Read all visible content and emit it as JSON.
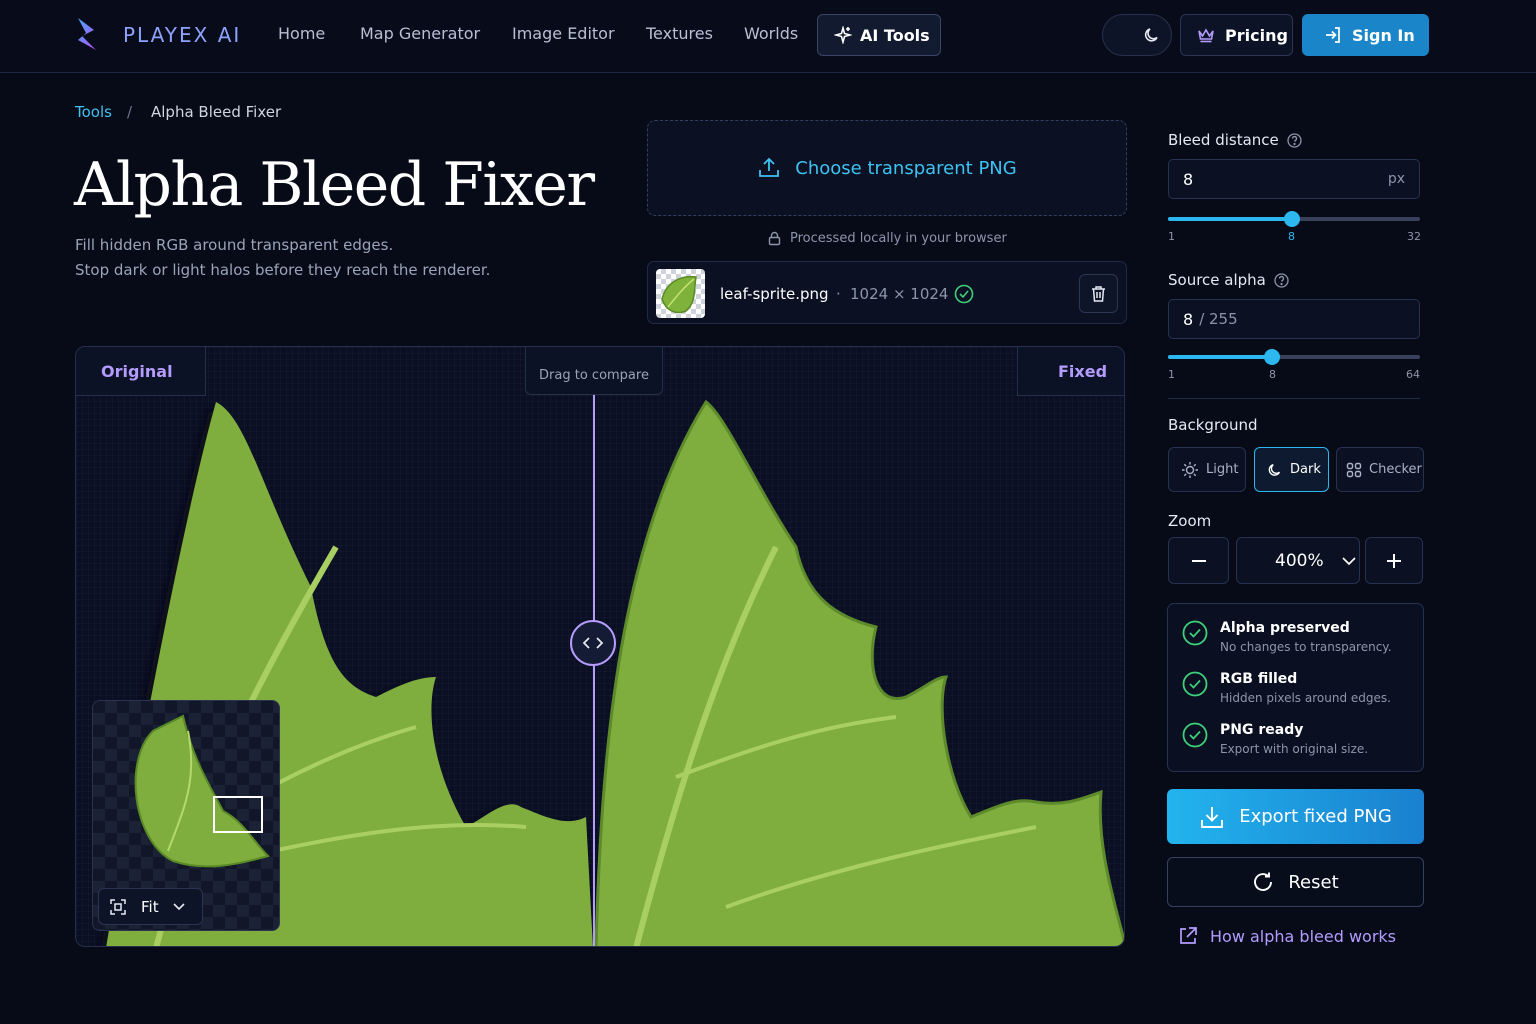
{
  "nav": {
    "brand": "PLAYEX AI",
    "links": [
      "Home",
      "Map Generator",
      "Image Editor",
      "Textures",
      "Worlds"
    ],
    "ai_tools": "AI Tools",
    "pricing": "Pricing",
    "sign_in": "Sign In"
  },
  "breadcrumb": {
    "root": "Tools",
    "sep": "/",
    "current": "Alpha Bleed Fixer"
  },
  "page": {
    "title": "Alpha Bleed Fixer",
    "subtitle_1": "Fill hidden RGB around transparent edges.",
    "subtitle_2": "Stop dark or light halos before they reach the renderer."
  },
  "upload": {
    "label": "Choose transparent PNG",
    "note": "Processed locally in your browser"
  },
  "file": {
    "name": "leaf-sprite.png",
    "dot": "·",
    "dims": "1024 × 1024"
  },
  "viewer": {
    "original": "Original",
    "fixed": "Fixed",
    "drag": "Drag to compare",
    "fit": "Fit",
    "split": 0.493
  },
  "settings": {
    "bleed_label": "Bleed distance",
    "bleed_value": "8",
    "bleed_unit": "px",
    "bleed_min": "1",
    "bleed_cur": "8",
    "bleed_max": "32",
    "alpha_label": "Source alpha",
    "alpha_value": "8",
    "alpha_denom": "/ 255",
    "alpha_min": "1",
    "alpha_cur": "8",
    "alpha_max": "64",
    "bg_label": "Background",
    "bg_options": [
      "Light",
      "Dark",
      "Checker"
    ],
    "bg_selected": "Dark",
    "zoom_label": "Zoom",
    "zoom_value": "400%"
  },
  "status": [
    {
      "title": "Alpha preserved",
      "desc": "No changes to transparency."
    },
    {
      "title": "RGB filled",
      "desc": "Hidden pixels around edges."
    },
    {
      "title": "PNG ready",
      "desc": "Export with original size."
    }
  ],
  "actions": {
    "export": "Export fixed PNG",
    "reset": "Reset",
    "help": "How alpha bleed works"
  },
  "colors": {
    "accent": "#2cb7ef",
    "purple": "#b59cff",
    "check": "#3ecf7a",
    "leaf": "#8fbf3c"
  }
}
